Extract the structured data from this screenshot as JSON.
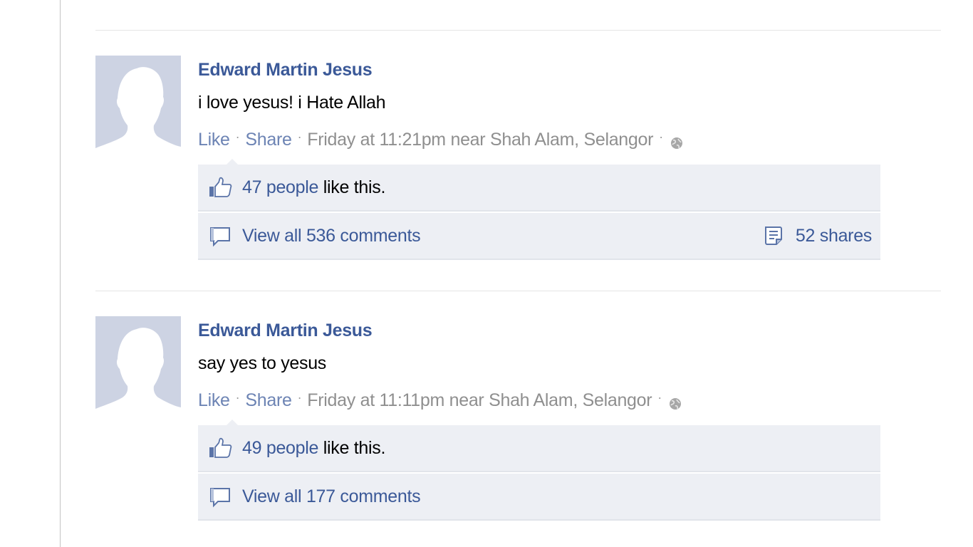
{
  "stories": [
    {
      "author": "Edward Martin Jesus",
      "message": "i love yesus! i Hate Allah",
      "actions": {
        "like": "Like",
        "share": "Share"
      },
      "timestamp": "Friday at 11:21pm near Shah Alam, Selangor",
      "privacy_icon": "globe-icon",
      "likes": {
        "count_text": "47 people",
        "suffix": " like this."
      },
      "comments": {
        "text": "View all 536 comments"
      },
      "shares": {
        "text": "52 shares"
      }
    },
    {
      "author": "Edward Martin Jesus",
      "message": "say yes to yesus",
      "actions": {
        "like": "Like",
        "share": "Share"
      },
      "timestamp": "Friday at 11:11pm near Shah Alam, Selangor",
      "privacy_icon": "globe-icon",
      "likes": {
        "count_text": "49 people",
        "suffix": " like this."
      },
      "comments": {
        "text": "View all 177 comments"
      }
    }
  ],
  "colors": {
    "link": "#3b5998",
    "meta_link": "#6d84b4",
    "meta_text": "#8f8f8f",
    "ufi_background": "#edeff4",
    "avatar_background": "#cdd3e3"
  }
}
